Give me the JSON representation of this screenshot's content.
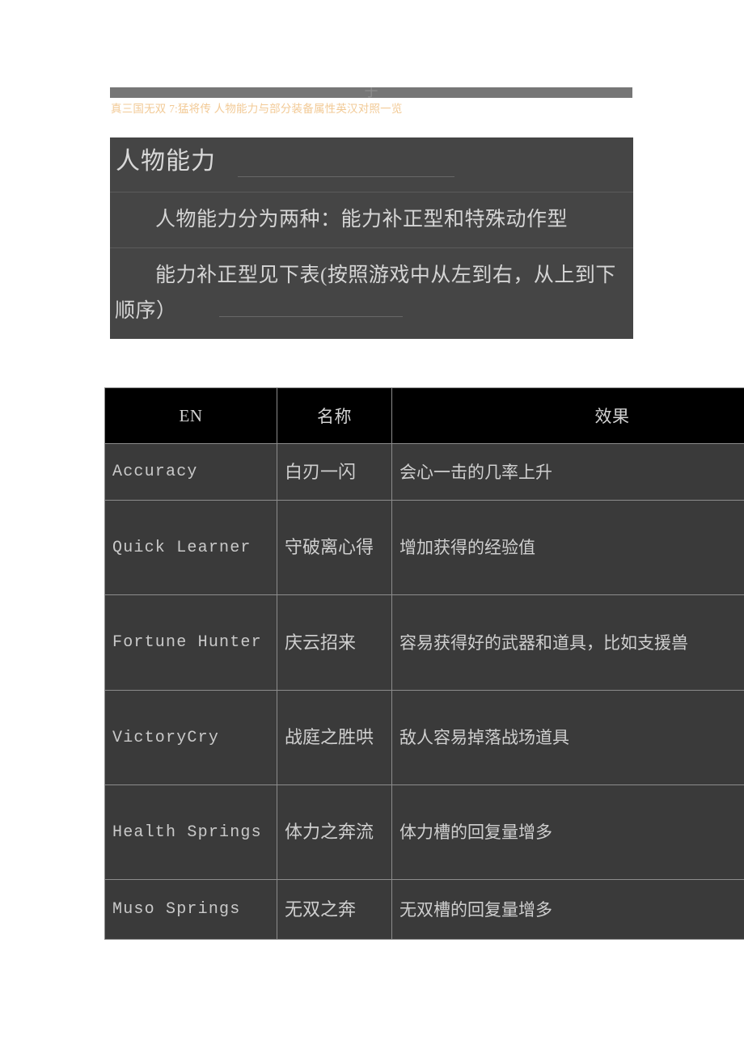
{
  "document": {
    "title": "真三国无双 7:猛将传  人物能力与部分装备属性英汉对照一览",
    "top_bar_ghost": "于",
    "title_color": "#f2ca96"
  },
  "panel": {
    "heading": "人物能力",
    "paragraphs": [
      "人物能力分为两种：能力补正型和特殊动作型",
      "能力补正型见下表(按照游戏中从左到右，从上到下顺序）"
    ],
    "background_color": "#454545"
  },
  "table": {
    "headers": [
      "EN",
      "名称",
      "效果"
    ],
    "header_background": "#000000",
    "row_background": "#3a3a3a",
    "border_color": "#8c8c8c",
    "rows": [
      {
        "en": "Accuracy",
        "name": "白刃一闪",
        "effect": "会心一击的几率上升"
      },
      {
        "en": "Quick Learner",
        "name": "守破离心得",
        "effect": "增加获得的经验值"
      },
      {
        "en": "Fortune Hunter",
        "name": "庆云招来",
        "effect": "容易获得好的武器和道具，比如支援兽"
      },
      {
        "en": "VictoryCry",
        "name": "战庭之胜哄",
        "effect": "敌人容易掉落战场道具"
      },
      {
        "en": "Health Springs",
        "name": "体力之奔流",
        "effect": "体力槽的回复量增多"
      },
      {
        "en": "Muso Springs",
        "name": "无双之奔",
        "effect": "无双槽的回复量增多"
      }
    ]
  }
}
